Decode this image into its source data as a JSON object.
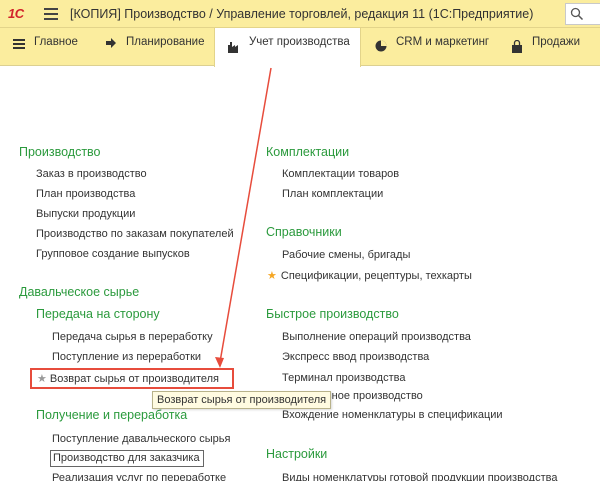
{
  "window": {
    "title": "[КОПИЯ] Производство / Управление торговлей, редакция 11  (1С:Предприятие)",
    "logo_text": "1С"
  },
  "menu": [
    {
      "label": "Главное",
      "icon": "hamburger-icon"
    },
    {
      "label": "Планирование",
      "icon": "planning-icon"
    },
    {
      "label": "Учет производства",
      "icon": "factory-icon"
    },
    {
      "label": "CRM и маркетинг",
      "icon": "pie-chart-icon"
    },
    {
      "label": "Продажи",
      "icon": "bag-icon"
    }
  ],
  "left": {
    "production": {
      "title": "Производство",
      "items": [
        "Заказ в производство",
        "План производства",
        "Выпуски продукции",
        "Производство по заказам покупателей",
        "Групповое создание выпусков"
      ]
    },
    "tolling": {
      "title": "Давальческое сырье",
      "transfer": {
        "title": "Передача на сторону",
        "items": [
          "Передача сырья в переработку",
          "Поступление из переработки",
          "Возврат сырья от производителя"
        ]
      },
      "receive": {
        "title": "Получение и переработка",
        "items": [
          "Поступление давальческого сырья",
          "Производство для заказчика",
          "Реализация услуг по переработке"
        ]
      }
    }
  },
  "right": {
    "kits": {
      "title": "Комплектации",
      "items": [
        "Комплектации товаров",
        "План комплектации"
      ]
    },
    "refs": {
      "title": "Справочники",
      "items": [
        "Рабочие смены, бригады",
        "Спецификации, рецептуры, техкарты"
      ]
    },
    "quick": {
      "title": "Быстрое производство",
      "items": [
        "Выполнение операций производства",
        "Экспресс ввод производства",
        "Терминал производства",
        "Оперативное производство",
        "Вхождение номенклатуры в спецификации"
      ]
    },
    "settings": {
      "title": "Настройки",
      "items": [
        "Виды номенклатуры готовой продукции производства"
      ]
    }
  },
  "tooltip": "Возврат сырья от производителя",
  "colors": {
    "accent_green": "#2b9a3d",
    "menubar": "#fbed9e",
    "annotation_red": "#e74c3c",
    "star": "#f5a623"
  }
}
